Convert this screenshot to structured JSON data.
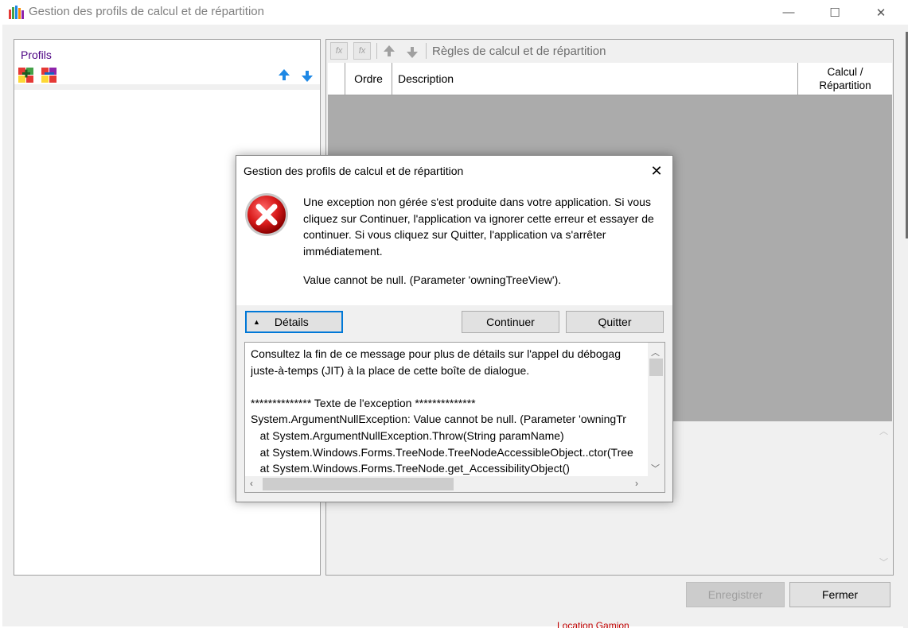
{
  "window": {
    "title": "Gestion des profils de calcul et de répartition",
    "min_glyph": "—",
    "max_glyph": "☐",
    "close_glyph": "✕"
  },
  "left_panel": {
    "label": "Profils",
    "icons": [
      "add-profile-icon",
      "remove-profile-icon",
      "arrow-up-icon",
      "arrow-down-icon"
    ]
  },
  "right_panel": {
    "toolbar_title": "Règles de calcul et de répartition",
    "fx_label": "fx",
    "columns": [
      {
        "label": "Ordre"
      },
      {
        "label": "Description"
      },
      {
        "label": "Calcul /\nRépartition"
      }
    ]
  },
  "footer": {
    "save_label": "Enregistrer",
    "close_label": "Fermer",
    "behind_text": "Location Gamion"
  },
  "dialog": {
    "title": "Gestion des profils de calcul et de répartition",
    "close_glyph": "✕",
    "message": "Une exception non gérée s'est produite dans votre application. Si vous cliquez sur Continuer, l'application va ignorer cette erreur et essayer de continuer. Si vous cliquez sur Quitter, l'application va s'arrêter immédiatement.",
    "error_detail": "Value cannot be null. (Parameter 'owningTreeView').",
    "details_label": "Détails",
    "details_glyph": "▲",
    "continue_label": "Continuer",
    "quit_label": "Quitter",
    "details_text": "Consultez la fin de ce message pour plus de détails sur l'appel du débogag\njuste-à-temps (JIT) à la place de cette boîte de dialogue.\n\n************** Texte de l'exception **************\nSystem.ArgumentNullException: Value cannot be null. (Parameter 'owningTr\n   at System.ArgumentNullException.Throw(String paramName)\n   at System.Windows.Forms.TreeNode.TreeNodeAccessibleObject..ctor(Tree\n   at System.Windows.Forms.TreeNode.get_AccessibilityObject()"
  },
  "colors": {
    "accent": "#0078d7",
    "grid_body": "#ababab",
    "error_red": "#c8102e",
    "profils_label": "#4b0082"
  }
}
